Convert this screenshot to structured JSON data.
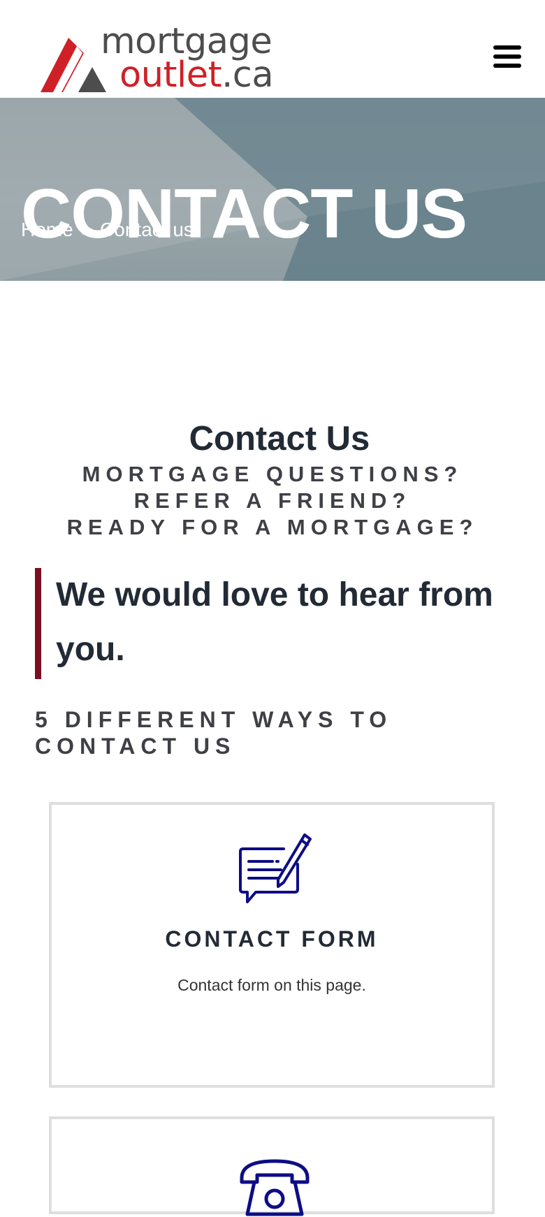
{
  "header": {
    "logo": {
      "line1": "mortgage",
      "line2_main": "outlet",
      "line2_suffix": ".ca"
    },
    "menu_icon": "hamburger-menu-icon"
  },
  "hero": {
    "title": "CONTACT US",
    "breadcrumb": {
      "home": "Home",
      "separator": ">",
      "current": "Contact us"
    }
  },
  "main": {
    "title": "Contact Us",
    "subtitle_line1": "MORTGAGE QUESTIONS? REFER A FRIEND?",
    "subtitle_line2": "READY FOR A MORTGAGE?",
    "quote": "We would love to hear from you.",
    "ways_heading": "5 DIFFERENT WAYS TO CONTACT US"
  },
  "cards": [
    {
      "icon": "contact-form-icon",
      "title": "CONTACT FORM",
      "description": "Contact form on this page."
    },
    {
      "icon": "phone-icon",
      "title": "",
      "description": ""
    }
  ],
  "colors": {
    "brand_red": "#cf2027",
    "brand_grey": "#4d4d4d",
    "accent_bar": "#7b0f22",
    "icon_blue": "#0d0d86",
    "text_dark": "#222a35"
  }
}
